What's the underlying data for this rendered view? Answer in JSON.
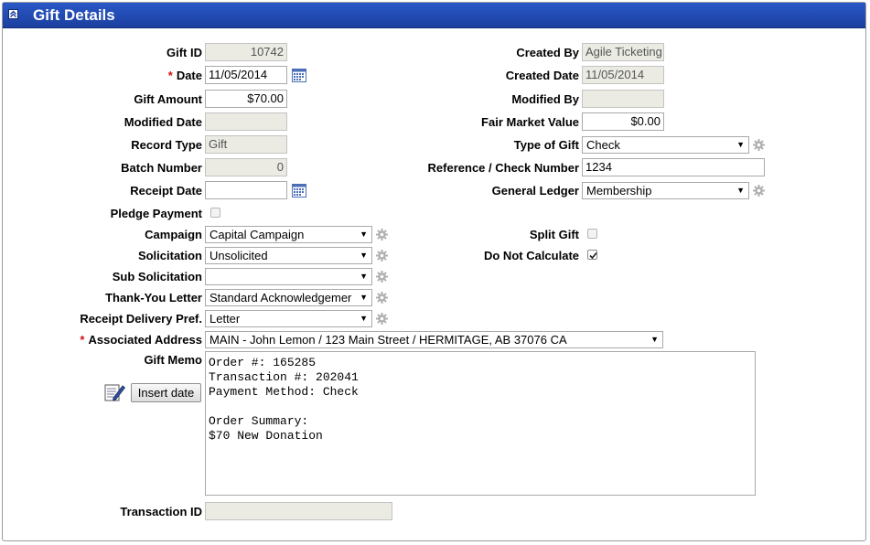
{
  "header": {
    "title": "Gift Details"
  },
  "left": {
    "gift_id": {
      "label": "Gift ID",
      "value": "10742"
    },
    "date": {
      "label": "Date",
      "required": "*",
      "value": "11/05/2014"
    },
    "gift_amount": {
      "label": "Gift Amount",
      "value": "$70.00"
    },
    "modified_date": {
      "label": "Modified Date",
      "value": ""
    },
    "record_type": {
      "label": "Record Type",
      "value": "Gift"
    },
    "batch_number": {
      "label": "Batch Number",
      "value": "0"
    },
    "receipt_date": {
      "label": "Receipt Date",
      "value": ""
    },
    "pledge_payment": {
      "label": "Pledge Payment",
      "checked": false
    },
    "campaign": {
      "label": "Campaign",
      "value": "Capital Campaign"
    },
    "solicitation": {
      "label": "Solicitation",
      "value": "Unsolicited"
    },
    "sub_solicitation": {
      "label": "Sub Solicitation",
      "value": ""
    },
    "thank_you_letter": {
      "label": "Thank-You Letter",
      "value": "Standard Acknowledgemer"
    },
    "receipt_delivery": {
      "label": "Receipt Delivery Pref.",
      "value": "Letter"
    },
    "associated_address": {
      "label": "Associated Address",
      "required": "*",
      "value": "MAIN - John Lemon / 123 Main Street / HERMITAGE, AB 37076 CA"
    },
    "gift_memo": {
      "label": "Gift Memo",
      "insert_date_label": "Insert date",
      "lines": [
        "Order #: 165285",
        "Transaction #: 202041",
        "Payment Method: Check",
        "",
        "Order Summary:",
        "$70 New Donation"
      ]
    },
    "transaction_id": {
      "label": "Transaction ID",
      "value": ""
    }
  },
  "right": {
    "created_by": {
      "label": "Created By",
      "value": "Agile Ticketing"
    },
    "created_date": {
      "label": "Created Date",
      "value": "11/05/2014"
    },
    "modified_by": {
      "label": "Modified By",
      "value": ""
    },
    "fair_market_value": {
      "label": "Fair Market Value",
      "value": "$0.00"
    },
    "type_of_gift": {
      "label": "Type of Gift",
      "value": "Check"
    },
    "reference_check_number": {
      "label": "Reference / Check Number",
      "value": "1234"
    },
    "general_ledger": {
      "label": "General Ledger",
      "value": "Membership"
    },
    "split_gift": {
      "label": "Split Gift",
      "checked": false
    },
    "do_not_calculate": {
      "label": "Do Not Calculate",
      "checked": true
    }
  },
  "icons": {
    "collapse": "chevron-up-icon",
    "calendar": "calendar-icon",
    "gear": "gear-icon",
    "edit": "edit-note-icon",
    "dropdown": "dropdown-caret-icon"
  },
  "colors": {
    "header_bg": "#1f48b0",
    "header_text": "#ffffff",
    "required": "#d01010",
    "readonly_bg": "#ebebe4"
  }
}
